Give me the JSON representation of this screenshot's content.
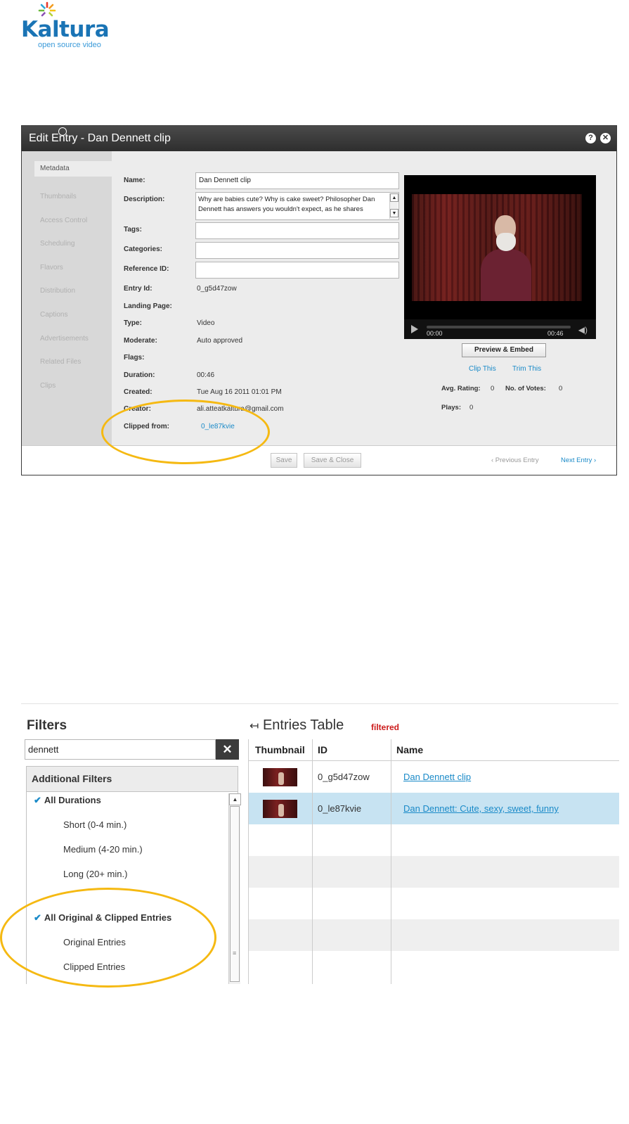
{
  "logo": {
    "word": "Kaltura",
    "tagline": "open source video"
  },
  "dialog": {
    "title": "Edit Entry - Dan Dennett clip",
    "help_icon": "?",
    "close_icon": "✕",
    "sidebar": [
      "Metadata",
      "Thumbnails",
      "Access Control",
      "Scheduling",
      "Flavors",
      "Distribution",
      "Captions",
      "Advertisements",
      "Related Files",
      "Clips"
    ],
    "fields": {
      "name_label": "Name:",
      "name_value": "Dan Dennett clip",
      "description_label": "Description:",
      "description_value": "Why are babies cute? Why is cake sweet? Philosopher Dan Dennett has answers you wouldn't expect, as he shares",
      "tags_label": "Tags:",
      "categories_label": "Categories:",
      "reference_label": "Reference ID:",
      "entry_id_label": "Entry Id:",
      "entry_id_value": "0_g5d47zow",
      "landing_label": "Landing Page:",
      "type_label": "Type:",
      "type_value": "Video",
      "moderate_label": "Moderate:",
      "moderate_value": "Auto approved",
      "flags_label": "Flags:",
      "duration_label": "Duration:",
      "duration_value": "00:46",
      "created_label": "Created:",
      "created_value": "Tue Aug 16 2011 01:01 PM",
      "creator_label": "Creator:",
      "creator_value": "ali.atteatkaltura@gmail.com",
      "clipped_label": "Clipped from:",
      "clipped_value": "0_le87kvie"
    },
    "player": {
      "time_start": "00:00",
      "time_end": "00:46"
    },
    "preview_button": "Preview & Embed",
    "clip_this": "Clip This",
    "trim_this": "Trim This",
    "avg_rating_label": "Avg. Rating:",
    "avg_rating_value": "0",
    "votes_label": "No. of Votes:",
    "votes_value": "0",
    "plays_label": "Plays:",
    "plays_value": "0",
    "save_button": "Save",
    "save_close_button": "Save & Close",
    "prev_entry": "‹ Previous Entry",
    "next_entry": "Next Entry ›"
  },
  "filters": {
    "title": "Filters",
    "search_value": "dennett",
    "clear_icon": "✕",
    "additional_filters": "Additional Filters",
    "durations": [
      "All Durations",
      "Short (0-4 min.)",
      "Medium (4-20 min.)",
      "Long (20+ min.)"
    ],
    "clip_types": [
      "All Original & Clipped Entries",
      "Original Entries",
      "Clipped Entries"
    ]
  },
  "entries": {
    "title": "Entries Table",
    "filtered_tag": "filtered",
    "headers": [
      "Thumbnail",
      "ID",
      "Name"
    ],
    "rows": [
      {
        "id": "0_g5d47zow",
        "name": "Dan Dennett clip"
      },
      {
        "id": "0_le87kvie",
        "name": "Dan Dennett: Cute, sexy, sweet, funny"
      }
    ]
  },
  "colors": {
    "accent": "#1a8ac8",
    "highlight": "#f5b912",
    "selected_row": "#c7e3f2",
    "filtered_tag": "#cc1b1b"
  }
}
